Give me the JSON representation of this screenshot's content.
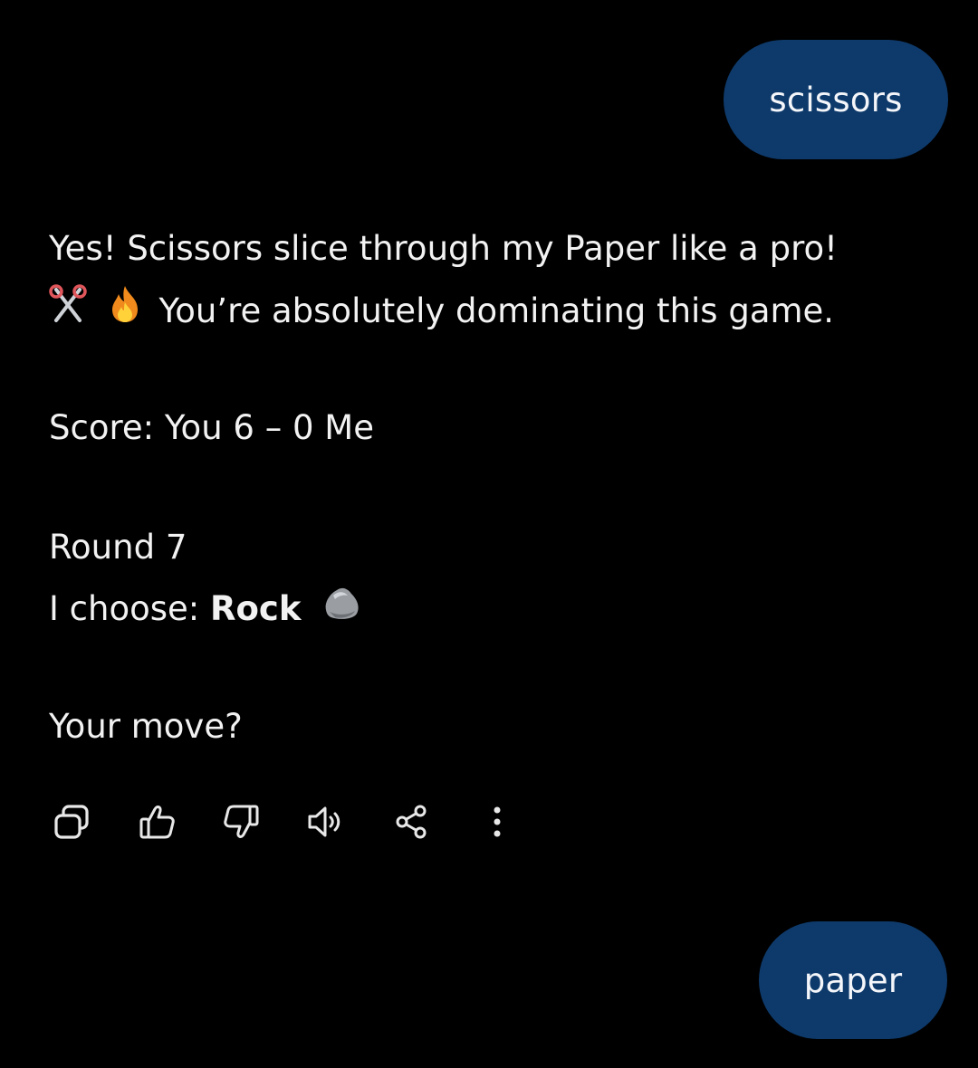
{
  "chat": {
    "user_message_1": "scissors",
    "assistant_reply": {
      "line1": "Yes! Scissors slice through my Paper like a pro!",
      "line2_emojis": [
        "scissors-icon",
        "fire-icon"
      ],
      "line2": "You’re absolutely dominating this game.",
      "score_label": "Score:",
      "score_value": "You 6 – 0 Me",
      "round": "Round 7",
      "choose_label": "I choose:",
      "choose_value": "Rock",
      "choose_emoji": "rock-icon",
      "prompt": "Your move?"
    },
    "user_message_2": "paper"
  },
  "actions": [
    "copy-icon",
    "thumbs-up-icon",
    "thumbs-down-icon",
    "speaker-icon",
    "share-icon",
    "more-icon"
  ],
  "colors": {
    "background": "#000000",
    "bubble": "#0e3a6b",
    "text": "#f2f2f2"
  }
}
